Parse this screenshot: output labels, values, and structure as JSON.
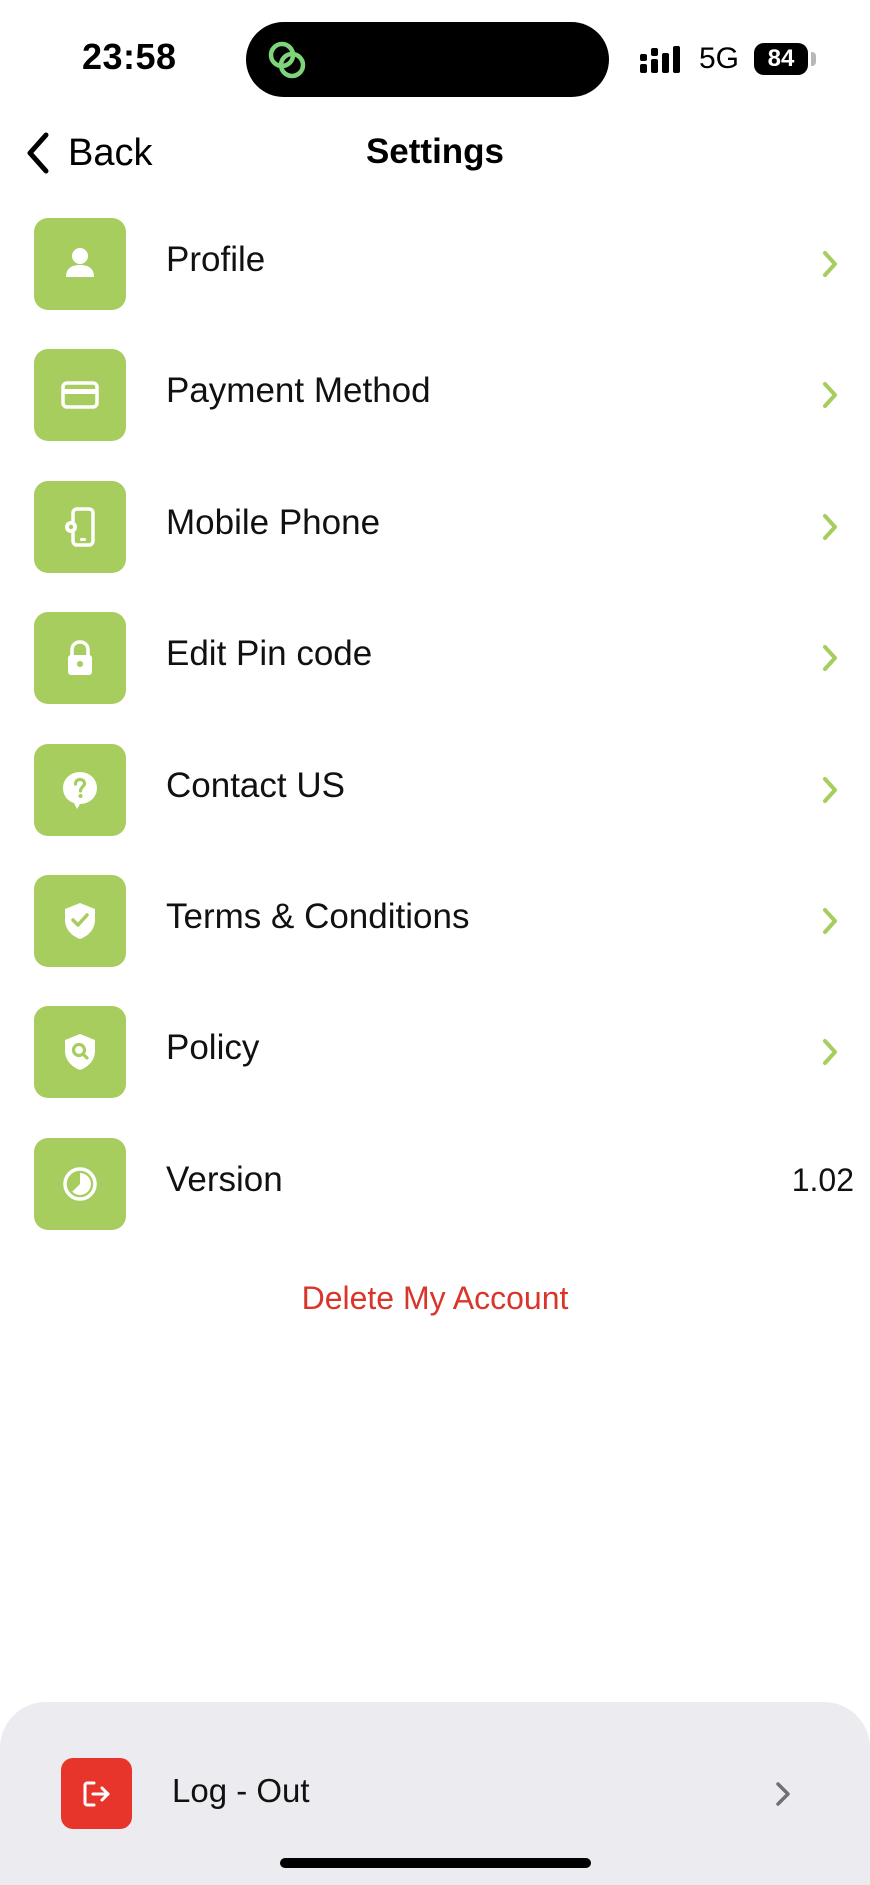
{
  "status_bar": {
    "time": "23:58",
    "network": "5G",
    "battery": "84",
    "island_app_icon": "chain-link-icon",
    "signal_icon": "cellular-signal-icon"
  },
  "nav": {
    "back_label": "Back",
    "title": "Settings"
  },
  "settings": {
    "items": [
      {
        "label": "Profile",
        "icon": "person-icon"
      },
      {
        "label": "Payment Method",
        "icon": "credit-card-icon"
      },
      {
        "label": "Mobile Phone",
        "icon": "phone-settings-icon"
      },
      {
        "label": "Edit Pin code",
        "icon": "lock-icon"
      },
      {
        "label": "Contact US",
        "icon": "help-bubble-icon"
      },
      {
        "label": "Terms & Conditions",
        "icon": "shield-check-icon"
      },
      {
        "label": "Policy",
        "icon": "shield-search-icon"
      },
      {
        "label": "Version",
        "icon": "clock-icon",
        "value": "1.02"
      }
    ]
  },
  "delete_account_label": "Delete My Account",
  "logout": {
    "label": "Log - Out",
    "icon": "logout-icon"
  },
  "colors": {
    "accent_green": "#a7cd5f",
    "danger_red": "#d9352b",
    "logout_red": "#e8352b",
    "sheet_background": "#ebebf0"
  }
}
